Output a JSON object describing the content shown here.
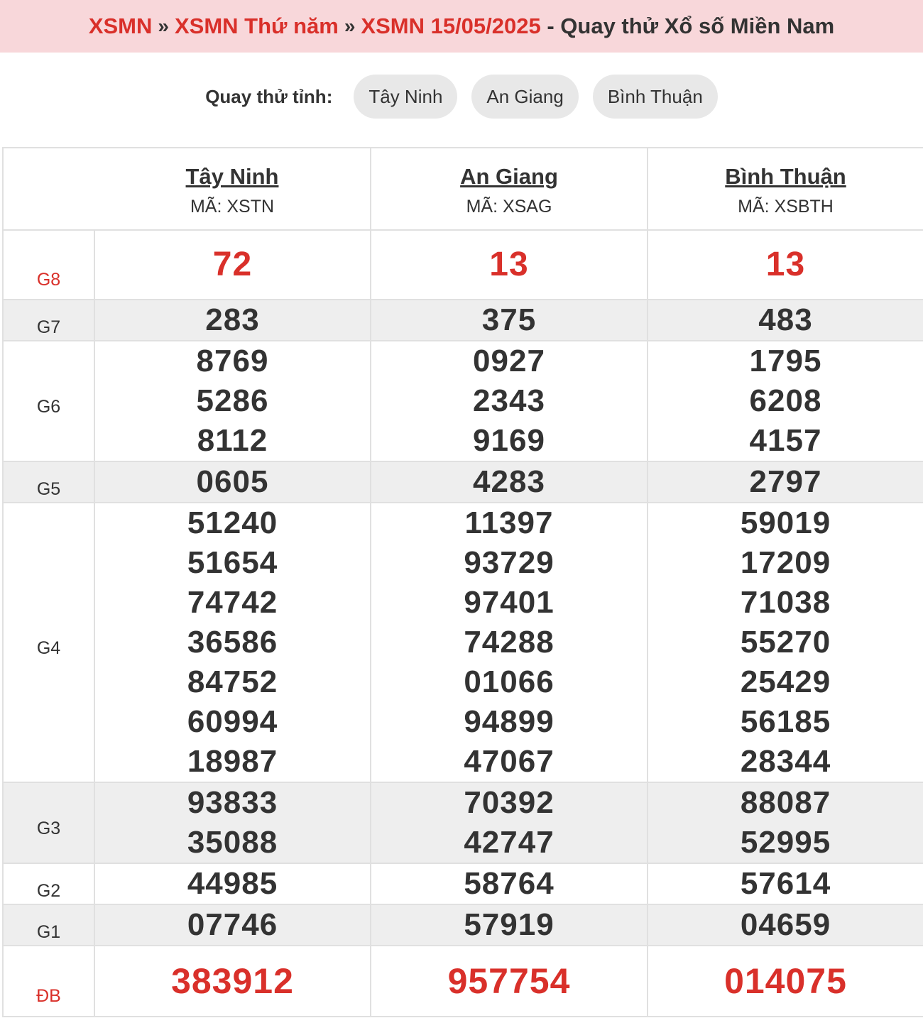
{
  "breadcrumb": {
    "items": [
      "XSMN",
      "XSMN Thứ năm",
      "XSMN 15/05/2025"
    ],
    "separator": "»",
    "suffix": " - Quay thử Xổ số Miền Nam"
  },
  "selector": {
    "label": "Quay thử tỉnh:",
    "provinces": [
      "Tây Ninh",
      "An Giang",
      "Bình Thuận"
    ]
  },
  "provinces": [
    {
      "name": "Tây Ninh",
      "code": "MÃ: XSTN"
    },
    {
      "name": "An Giang",
      "code": "MÃ: XSAG"
    },
    {
      "name": "Bình Thuận",
      "code": "MÃ: XSBTH"
    }
  ],
  "prizes": {
    "g8": {
      "label": "G8",
      "values": [
        [
          "72"
        ],
        [
          "13"
        ],
        [
          "13"
        ]
      ]
    },
    "g7": {
      "label": "G7",
      "values": [
        [
          "283"
        ],
        [
          "375"
        ],
        [
          "483"
        ]
      ]
    },
    "g6": {
      "label": "G6",
      "values": [
        [
          "8769",
          "5286",
          "8112"
        ],
        [
          "0927",
          "2343",
          "9169"
        ],
        [
          "1795",
          "6208",
          "4157"
        ]
      ]
    },
    "g5": {
      "label": "G5",
      "values": [
        [
          "0605"
        ],
        [
          "4283"
        ],
        [
          "2797"
        ]
      ]
    },
    "g4": {
      "label": "G4",
      "values": [
        [
          "51240",
          "51654",
          "74742",
          "36586",
          "84752",
          "60994",
          "18987"
        ],
        [
          "11397",
          "93729",
          "97401",
          "74288",
          "01066",
          "94899",
          "47067"
        ],
        [
          "59019",
          "17209",
          "71038",
          "55270",
          "25429",
          "56185",
          "28344"
        ]
      ]
    },
    "g3": {
      "label": "G3",
      "values": [
        [
          "93833",
          "35088"
        ],
        [
          "70392",
          "42747"
        ],
        [
          "88087",
          "52995"
        ]
      ]
    },
    "g2": {
      "label": "G2",
      "values": [
        [
          "44985"
        ],
        [
          "58764"
        ],
        [
          "57614"
        ]
      ]
    },
    "g1": {
      "label": "G1",
      "values": [
        [
          "07746"
        ],
        [
          "57919"
        ],
        [
          "04659"
        ]
      ]
    },
    "db": {
      "label": "ĐB",
      "values": [
        [
          "383912"
        ],
        [
          "957754"
        ],
        [
          "014075"
        ]
      ]
    }
  },
  "colors": {
    "accent_red": "#d9302a",
    "header_bg": "#f8d7da",
    "alt_row_bg": "#eeeeee",
    "pill_bg": "#e8e8e8"
  }
}
